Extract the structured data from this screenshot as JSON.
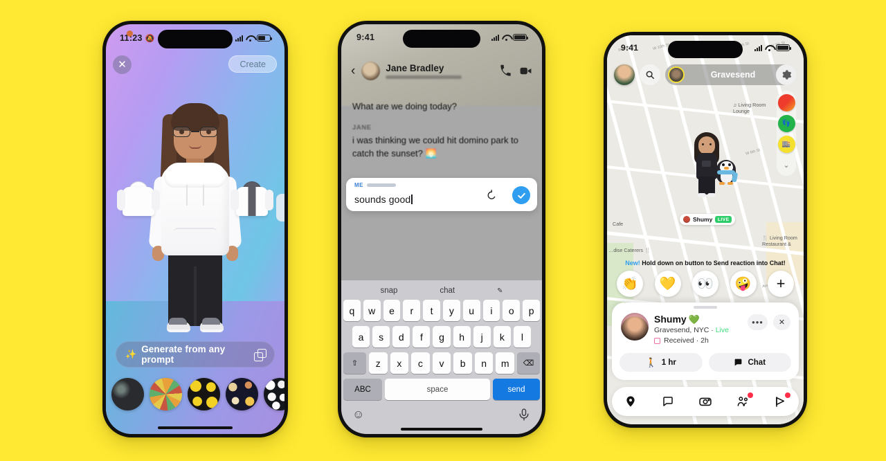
{
  "background_color": "#FFE933",
  "phone1": {
    "name": "avatar-builder",
    "status": {
      "time": "11:23",
      "mute_icon": "bell-slash-icon"
    },
    "close_label": "✕",
    "create_label": "Create",
    "prompt": {
      "sparkle_icon": "sparkle-icon",
      "label": "Generate from any prompt",
      "dice_icon": "shuffle-icon"
    },
    "thumbnails": [
      {
        "name": "style-thumb-dark-collage"
      },
      {
        "name": "style-thumb-emoji-collage"
      },
      {
        "name": "style-thumb-crown-money"
      },
      {
        "name": "style-thumb-planets"
      },
      {
        "name": "style-thumb-pearls"
      },
      {
        "name": "style-thumb-yellow"
      }
    ],
    "clothing_options": [
      {
        "name": "white-hoodie-option"
      },
      {
        "name": "grey-zip-hoodie-option"
      }
    ]
  },
  "phone2": {
    "name": "chat-conversation",
    "status": {
      "time": "9:41"
    },
    "back_label": "‹",
    "contact_name": "Jane Bradley",
    "call_icon": "phone-icon",
    "video_icon": "video-camera-icon",
    "messages": [
      {
        "label": "",
        "text": "What are we doing today?"
      },
      {
        "label": "JANE",
        "text": "i was thinking we could hit domino park to catch the sunset? 🌅"
      }
    ],
    "input": {
      "sender_label": "ME",
      "value": "sounds good",
      "undo_icon": "undo-icon",
      "send_icon": "check-circle-icon"
    },
    "keyboard": {
      "tabs": [
        "snap",
        "chat"
      ],
      "pencil_icon": "pencil-icon",
      "row1": [
        "q",
        "w",
        "e",
        "r",
        "t",
        "y",
        "u",
        "i",
        "o",
        "p"
      ],
      "row2": [
        "a",
        "s",
        "d",
        "f",
        "g",
        "h",
        "j",
        "k",
        "l"
      ],
      "row3": [
        "z",
        "x",
        "c",
        "v",
        "b",
        "n",
        "m"
      ],
      "shift_icon": "shift-icon",
      "backspace_icon": "backspace-icon",
      "abc_label": "ABC",
      "space_label": "space",
      "send_label": "send",
      "emoji_icon": "emoji-icon",
      "mic_icon": "microphone-icon"
    }
  },
  "phone3": {
    "name": "snap-map",
    "status": {
      "time": "9:41"
    },
    "my_avatar_name": "my-bitmoji-avatar",
    "search_icon": "search-icon",
    "place_label": "Gravesend",
    "gear_icon": "gear-icon",
    "side_buttons": [
      {
        "name": "heatmap-button",
        "icon": "heat-icon"
      },
      {
        "name": "friends-layer-button",
        "icon": "friend-pin-icon"
      },
      {
        "name": "places-layer-button",
        "icon": "places-icon"
      },
      {
        "name": "collapse-button",
        "icon": "chevron-down-icon"
      }
    ],
    "map_labels": [
      {
        "text": "Living Room Lounge",
        "icon": "music-note-icon"
      },
      {
        "text": "Cafe",
        "icon": ""
      },
      {
        "text": "Living Room Restaurant &",
        "icon": "fork-knife-icon"
      },
      {
        "text": "…dise Caterers",
        "icon": "fork-knife-icon"
      }
    ],
    "street_labels": [
      "W 11th St",
      "W 10th St",
      "W 9th St",
      "W 8th St",
      "W 7th St",
      "W 6th St",
      "W 5th St",
      "Avenue V"
    ],
    "map_pin": {
      "name": "Shumy",
      "live_badge": "LIVE"
    },
    "tip": {
      "new_label": "New!",
      "text": "Hold down on button to Send reaction into Chat!"
    },
    "reactions": [
      "👏",
      "💛",
      "👀",
      "🤪",
      "+"
    ],
    "card": {
      "name": "Shumy",
      "heart": "💚",
      "location": "Gravesend, NYC · ",
      "live": "Live",
      "received": "Received · 2h",
      "more_label": "•••",
      "close_label": "✕",
      "actions": [
        {
          "icon": "walking-icon",
          "label": "1 hr"
        },
        {
          "icon": "chat-bubble-icon",
          "label": "Chat"
        }
      ]
    },
    "nav": [
      {
        "name": "nav-map",
        "icon": "location-pin-icon",
        "badge": false
      },
      {
        "name": "nav-chat",
        "icon": "chat-bubble-icon",
        "badge": false
      },
      {
        "name": "nav-camera",
        "icon": "camera-icon",
        "badge": false
      },
      {
        "name": "nav-friends",
        "icon": "friends-icon",
        "badge": true
      },
      {
        "name": "nav-stories",
        "icon": "play-arrow-icon",
        "badge": true
      }
    ]
  }
}
